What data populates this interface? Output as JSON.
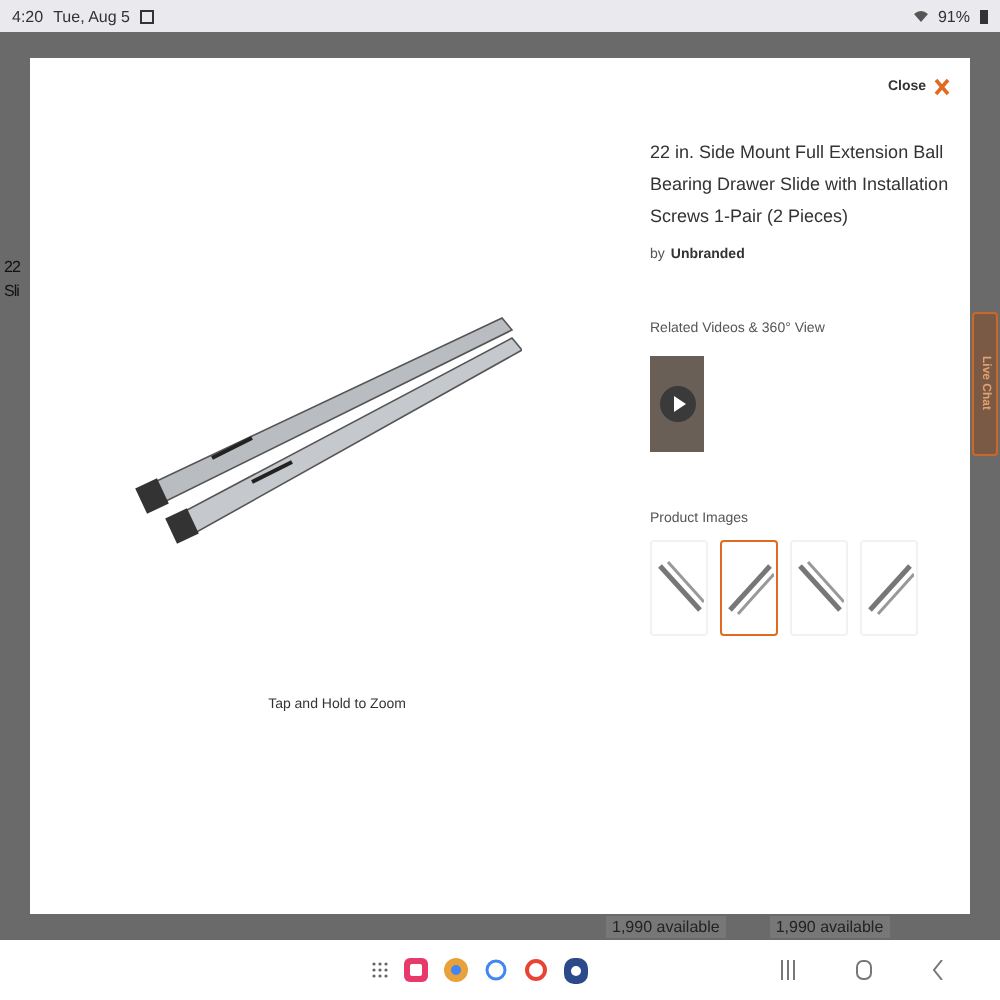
{
  "status_bar": {
    "time": "4:20",
    "date": "Tue, Aug 5",
    "battery": "91%"
  },
  "background_page": {
    "title_lines": [
      "22",
      "Sli"
    ],
    "availability": [
      "1,990 available",
      "1,990 available"
    ],
    "live_chat": "Live Chat"
  },
  "modal": {
    "close": "Close",
    "title": "22 in. Side Mount Full Extension Ball Bearing Drawer Slide with Installation Screws 1-Pair (2 Pieces)",
    "by": "by",
    "brand": "Unbranded",
    "zoom_hint": "Tap and Hold to Zoom",
    "videos_heading": "Related Videos & 360° View",
    "images_heading": "Product Images",
    "thumbnails": [
      {
        "selected": false
      },
      {
        "selected": true
      },
      {
        "selected": false
      },
      {
        "selected": false
      }
    ]
  }
}
